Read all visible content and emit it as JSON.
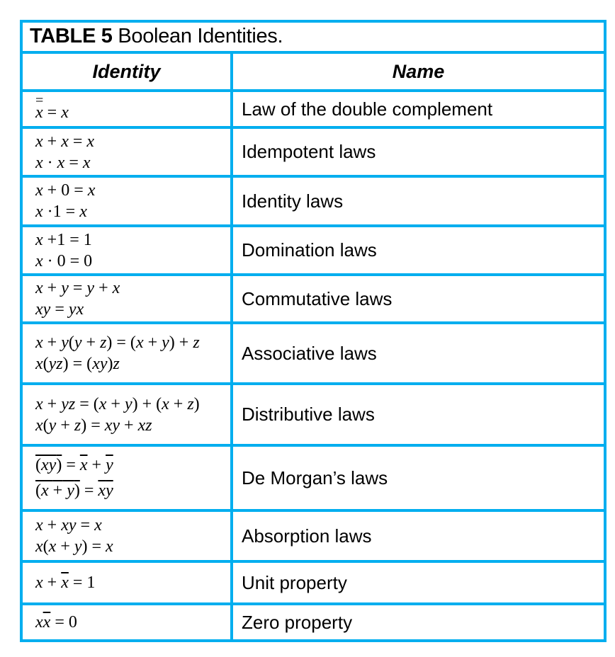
{
  "table": {
    "title_bold": "TABLE 5",
    "title_rest": " Boolean Identities.",
    "headers": {
      "identity": "Identity",
      "name": "Name"
    },
    "border_color": "#00AEEF",
    "rows": [
      {
        "identity": [
          "x̿ = x"
        ],
        "name": "Law of the double complement"
      },
      {
        "identity": [
          "x + x = x",
          "x · x = x"
        ],
        "name": "Idempotent laws"
      },
      {
        "identity": [
          "x + 0 = x",
          "x · 1 = x"
        ],
        "name": "Identity laws"
      },
      {
        "identity": [
          "x + 1 = 1",
          "x · 0 = 0"
        ],
        "name": "Domination laws"
      },
      {
        "identity": [
          "x + y = y + x",
          "xy = yx"
        ],
        "name": "Commutative laws"
      },
      {
        "identity": [
          "x + y(y + z) = (x + y) + z",
          "x(yz) = (xy)z"
        ],
        "name": "Associative laws"
      },
      {
        "identity": [
          "x + yz = (x + y) + (x + z)",
          "x(y + z) = xy + xz"
        ],
        "name": "Distributive laws"
      },
      {
        "identity": [
          "(xy)‾ = x̄ + ȳ",
          "(x + y)‾ = x̄ȳ"
        ],
        "name": "De Morgan’s laws"
      },
      {
        "identity": [
          "x + xy = x",
          "x(x + y) = x"
        ],
        "name": "Absorption laws"
      },
      {
        "identity": [
          "x + x̄ = 1"
        ],
        "name": "Unit property"
      },
      {
        "identity": [
          "xx̄ = 0"
        ],
        "name": "Zero property"
      }
    ]
  }
}
